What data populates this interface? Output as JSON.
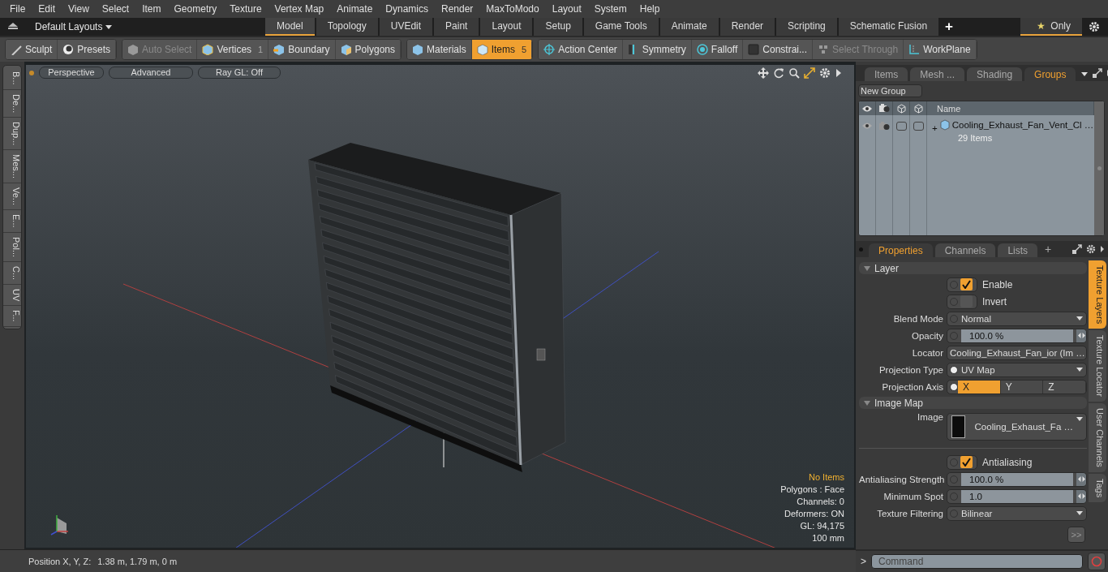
{
  "menu": [
    "File",
    "Edit",
    "View",
    "Select",
    "Item",
    "Geometry",
    "Texture",
    "Vertex Map",
    "Animate",
    "Dynamics",
    "Render",
    "MaxToModo",
    "Layout",
    "System",
    "Help"
  ],
  "layout_bar": {
    "layout_menu": "Default Layouts",
    "tabs": [
      {
        "label": "Model",
        "selected": true
      },
      {
        "label": "Topology",
        "selected": false
      },
      {
        "label": "UVEdit",
        "selected": false
      },
      {
        "label": "Paint",
        "selected": false
      },
      {
        "label": "Layout",
        "selected": false
      },
      {
        "label": "Setup",
        "selected": false
      },
      {
        "label": "Game Tools",
        "selected": false
      },
      {
        "label": "Animate",
        "selected": false
      },
      {
        "label": "Render",
        "selected": false
      },
      {
        "label": "Scripting",
        "selected": false
      },
      {
        "label": "Schematic Fusion",
        "selected": false
      }
    ],
    "add_tab": "+",
    "filter": {
      "star": "★",
      "label": "Only"
    }
  },
  "toolbar": {
    "groups": [
      {
        "buttons": [
          {
            "label": "Sculpt",
            "disabled": false,
            "selected": false
          },
          {
            "label": "Presets",
            "disabled": false,
            "selected": false
          }
        ]
      },
      {
        "buttons": [
          {
            "label": "Auto Select",
            "disabled": true,
            "selected": false
          },
          {
            "label": "Vertices",
            "count": "1",
            "disabled": false,
            "selected": false
          },
          {
            "label": "Boundary",
            "disabled": false,
            "selected": false
          },
          {
            "label": "Polygons",
            "disabled": false,
            "selected": false
          }
        ]
      },
      {
        "buttons": [
          {
            "label": "Materials",
            "disabled": false,
            "selected": false
          },
          {
            "label": "Items",
            "count": "5",
            "disabled": false,
            "selected": true
          }
        ]
      },
      {
        "buttons": [
          {
            "label": "Action Center",
            "disabled": false,
            "selected": false
          },
          {
            "label": "Symmetry",
            "disabled": false,
            "selected": false
          },
          {
            "label": "Falloff",
            "disabled": false,
            "selected": false
          },
          {
            "label": "Constrai...",
            "disabled": false,
            "selected": false
          },
          {
            "label": "Select Through",
            "disabled": true,
            "selected": false
          },
          {
            "label": "WorkPlane",
            "disabled": false,
            "selected": false
          }
        ]
      }
    ]
  },
  "side_tabs": [
    "B...",
    "De...",
    "Dup...",
    "Mes...",
    "Ve...",
    "E...",
    "Pol...",
    "C...",
    "UV",
    "F..."
  ],
  "viewport": {
    "buttons": [
      "Perspective",
      "Advanced",
      "Ray GL: Off"
    ],
    "info": [
      {
        "text": "No Items",
        "kind": "highlight"
      },
      {
        "text": "Polygons : Face",
        "kind": "plain"
      },
      {
        "text": "Channels: 0",
        "kind": "plain"
      },
      {
        "text": "Deformers: ON",
        "kind": "plain"
      },
      {
        "text": "GL: 94,175",
        "kind": "plain"
      },
      {
        "text": "100 mm",
        "kind": "plain"
      }
    ]
  },
  "groups_panel": {
    "tabs": [
      {
        "label": "Items",
        "selected": false
      },
      {
        "label": "Mesh ...",
        "selected": false
      },
      {
        "label": "Shading",
        "selected": false
      },
      {
        "label": "Groups",
        "selected": true
      }
    ],
    "new_group": "New Group",
    "name_column": "Name",
    "rows": [
      {
        "lock": false,
        "select": false,
        "expand": "+",
        "name": "Cooling_Exhaust_Fan_Vent_Cl …",
        "count": "29 Items"
      }
    ]
  },
  "properties": {
    "tabs": [
      {
        "label": "Properties",
        "selected": true
      },
      {
        "label": "Channels",
        "selected": false
      },
      {
        "label": "Lists",
        "selected": false
      }
    ],
    "add_tab": "+",
    "sections": [
      {
        "title": "Layer",
        "rows": [
          {
            "kind": "checkbox",
            "label": "Enable",
            "checked": true
          },
          {
            "kind": "checkbox",
            "label": "Invert",
            "checked": false
          },
          {
            "kind": "dropdown",
            "label": "Blend Mode",
            "value": "Normal",
            "radio": false
          },
          {
            "kind": "number",
            "label": "Opacity",
            "value": "100.0 %",
            "radio": false
          },
          {
            "kind": "dropdown",
            "label": "Locator",
            "value": "Cooling_Exhaust_Fan_ior (Im …"
          },
          {
            "kind": "dropdown",
            "label": "Projection Type",
            "value": "UV Map",
            "radio": true
          },
          {
            "kind": "axis",
            "label": "Projection Axis",
            "radio": true,
            "options": [
              {
                "label": "X",
                "selected": true
              },
              {
                "label": "Y",
                "selected": false
              },
              {
                "label": "Z",
                "selected": false
              }
            ]
          }
        ]
      },
      {
        "title": "Image Map",
        "rows": [
          {
            "kind": "image",
            "label": "Image",
            "value": "Cooling_Exhaust_Fa …"
          }
        ]
      },
      {
        "rows": [
          {
            "kind": "checkbox",
            "label": "Antialiasing",
            "checked": true
          },
          {
            "kind": "number",
            "label": "Antialiasing Strength",
            "value": "100.0 %",
            "radio": false
          },
          {
            "kind": "number",
            "label": "Minimum Spot",
            "value": "1.0",
            "radio": false
          },
          {
            "kind": "dropdown",
            "label": "Texture Filtering",
            "value": "Bilinear",
            "radio": false
          }
        ]
      }
    ],
    "more": ">>",
    "side_tabs": [
      {
        "label": "Texture Layers",
        "selected": true
      },
      {
        "label": "Texture Locator",
        "selected": false
      },
      {
        "label": "User Channels",
        "selected": false
      },
      {
        "label": "Tags",
        "selected": false
      }
    ]
  },
  "command": {
    "prompt": ">",
    "placeholder": "Command"
  },
  "status": {
    "label": "Position X, Y, Z:",
    "value": "1.38 m, 1.79 m, 0 m"
  }
}
